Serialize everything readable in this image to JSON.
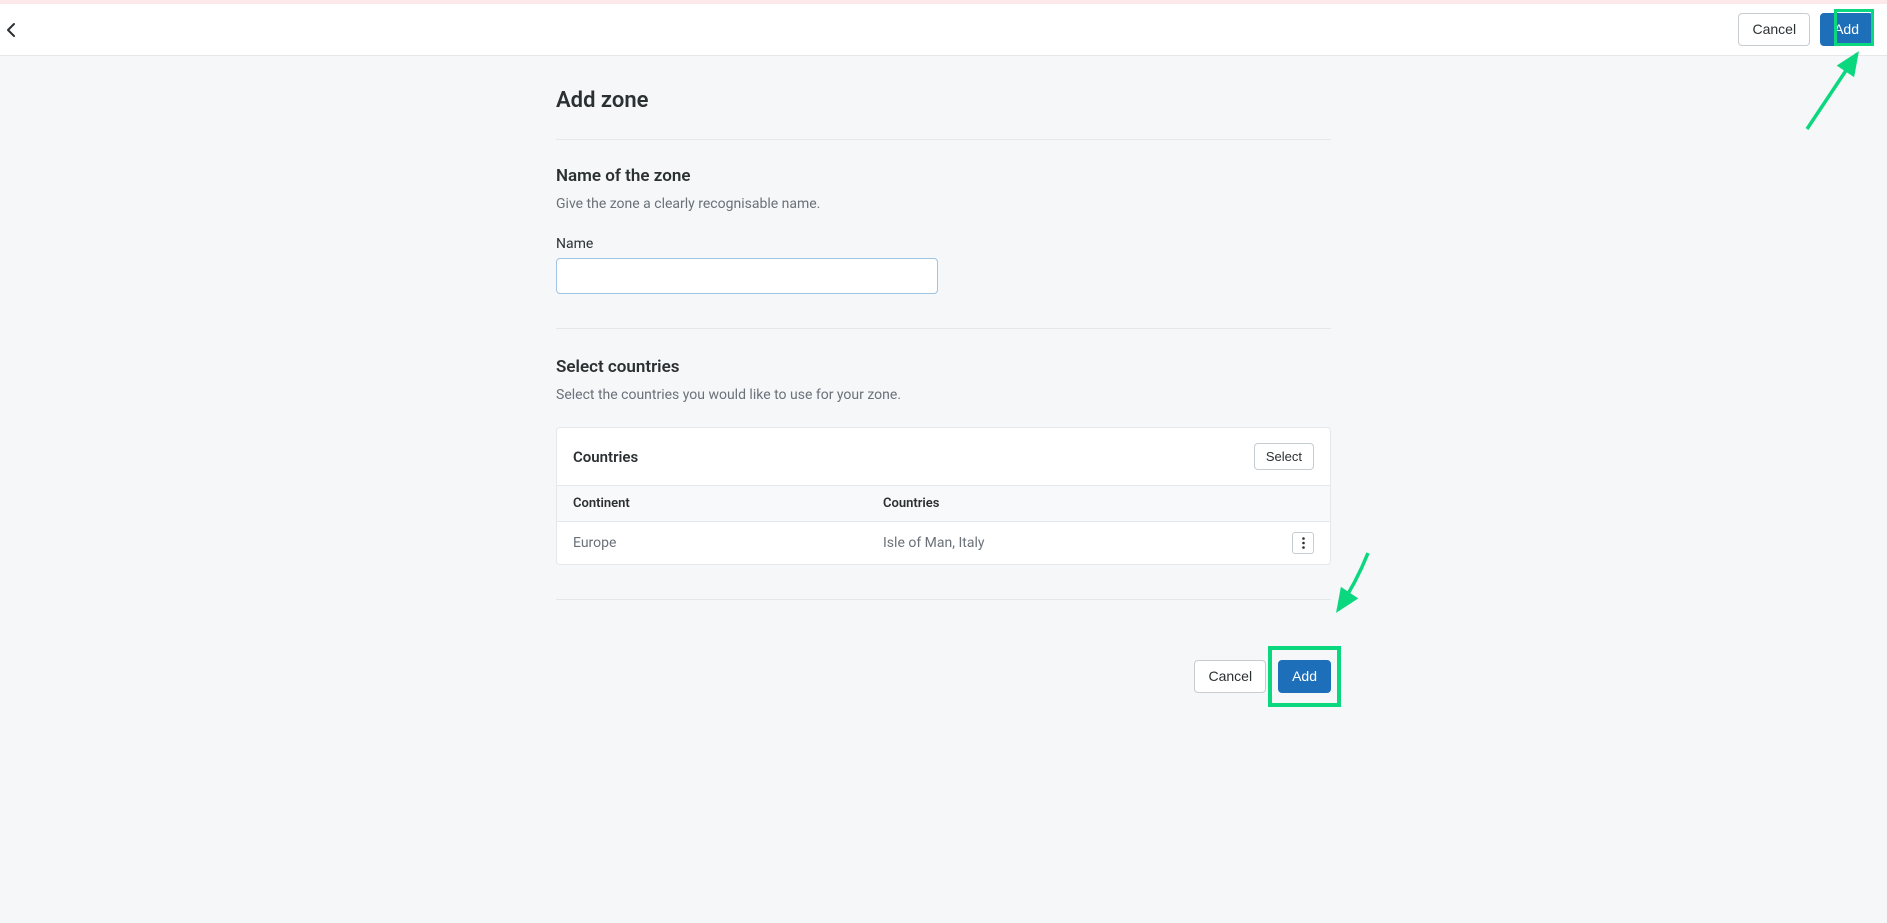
{
  "header": {
    "cancel_label": "Cancel",
    "add_label": "Add"
  },
  "page": {
    "title": "Add zone"
  },
  "name_section": {
    "title": "Name of the zone",
    "description": "Give the zone a clearly recognisable name.",
    "field_label": "Name",
    "field_value": ""
  },
  "countries_section": {
    "title": "Select countries",
    "description": "Select the countries you would like to use for your zone.",
    "card_title": "Countries",
    "select_label": "Select",
    "columns": {
      "continent": "Continent",
      "countries": "Countries"
    },
    "rows": [
      {
        "continent": "Europe",
        "countries": "Isle of Man, Italy"
      }
    ]
  },
  "footer": {
    "cancel_label": "Cancel",
    "add_label": "Add"
  },
  "annotation": {
    "accent_color": "#0bd77e"
  }
}
